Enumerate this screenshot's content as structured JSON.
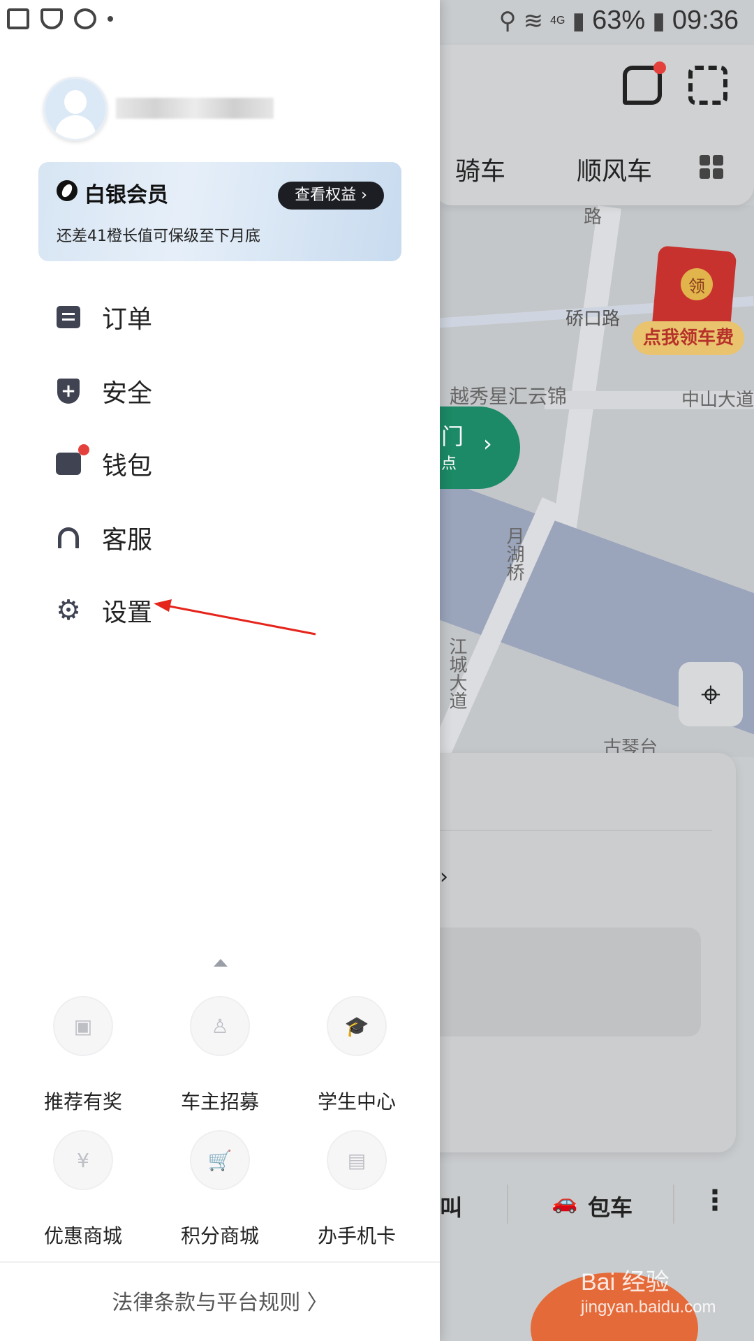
{
  "status_bar": {
    "battery": "63%",
    "time": "09:36",
    "network": "4G"
  },
  "drawer": {
    "member": {
      "title": "白银会员",
      "subtitle": "还差41橙长值可保级至下月底",
      "benefits_button": "查看权益 ›"
    },
    "menu": [
      {
        "label": "订单",
        "icon": "order-icon"
      },
      {
        "label": "安全",
        "icon": "shield-icon"
      },
      {
        "label": "钱包",
        "icon": "wallet-icon"
      },
      {
        "label": "客服",
        "icon": "headset-icon"
      },
      {
        "label": "设置",
        "icon": "gear-icon"
      }
    ],
    "grid": [
      {
        "label": "推荐有奖",
        "icon": "gift-icon"
      },
      {
        "label": "车主招募",
        "icon": "driver-icon"
      },
      {
        "label": "学生中心",
        "icon": "graduation-cap-icon"
      },
      {
        "label": "优惠商城",
        "icon": "yen-tag-icon"
      },
      {
        "label": "积分商城",
        "icon": "cart-icon"
      },
      {
        "label": "办手机卡",
        "icon": "sim-card-icon"
      }
    ],
    "footer_link": "法律条款与平台规则 〉"
  },
  "background": {
    "tabs": [
      "骑车",
      "顺风车"
    ],
    "map_labels": [
      "路",
      "硚口路",
      "越秀星汇云锦",
      "中山大道",
      "月湖桥",
      "江城大道",
      "古琴台"
    ],
    "green_pill": {
      "line1": "门",
      "line2": "点"
    },
    "red_packet": {
      "coin": "领",
      "label": "点我领车费"
    },
    "bottom": {
      "left": "叫",
      "charter": "包车"
    }
  },
  "watermark": {
    "main": "Bai 经验",
    "sub": "jingyan.baidu.com"
  },
  "colors": {
    "accent_red": "#e5413c",
    "drawer_bg": "#ffffff",
    "icon_dark": "#3f4352",
    "green": "#1c8a66"
  }
}
